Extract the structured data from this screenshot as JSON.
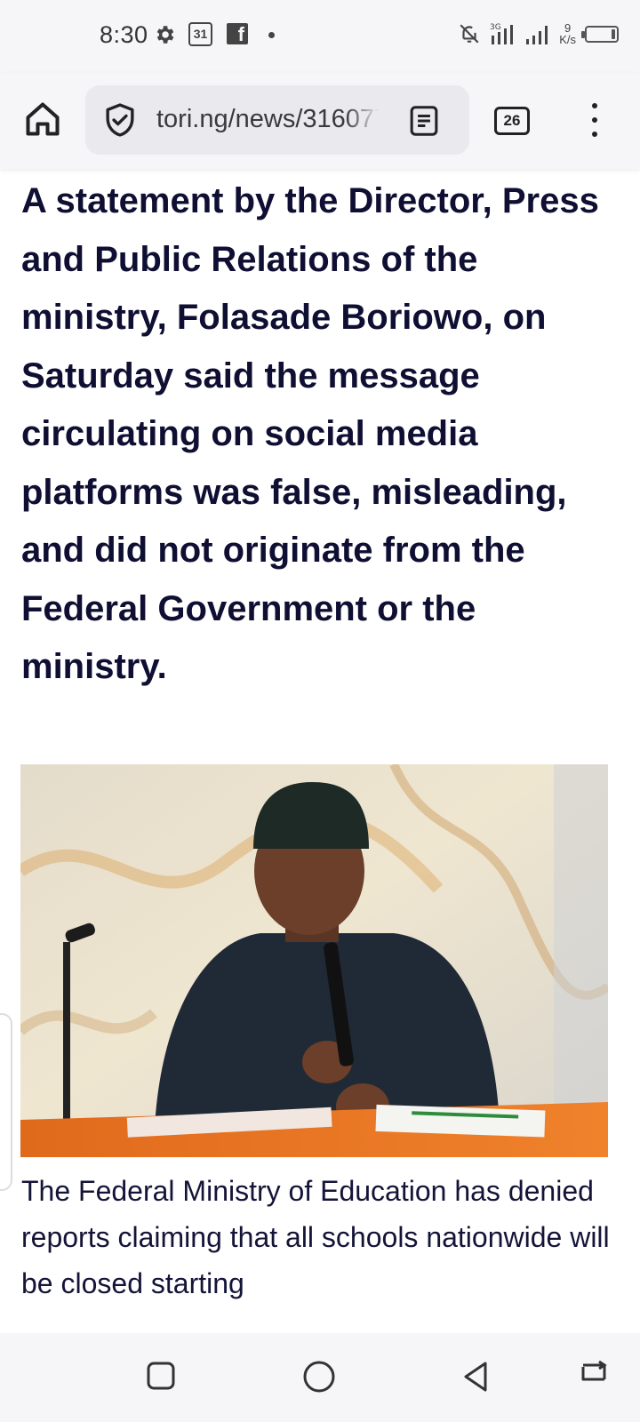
{
  "status_bar": {
    "time": "8:30",
    "calendar_day": "31",
    "net_speed_value": "9",
    "net_speed_unit": "K/s",
    "signal_label": "3G",
    "battery_level_percent": 15
  },
  "browser": {
    "url": "tori.ng/news/316077",
    "tab_count": "26"
  },
  "article": {
    "lead_paragraph": "A statement by the Director, Press and Public Relations of the ministry, Folasade Boriowo, on Saturday said the message circulating on social media platforms was false, misleading, and did not originate from the Federal Government or the ministry.",
    "body_paragraph": "The Federal Ministry of Education has denied reports claiming that all schools nationwide will be closed starting"
  },
  "colors": {
    "text": "#0f0f33",
    "chrome_background": "#f6f6f8",
    "url_bar_background": "#e9e9ee"
  },
  "icons": {
    "home": "home-icon",
    "security": "shield-check-icon",
    "reader": "reader-mode-icon",
    "menu": "more-vert-icon"
  }
}
